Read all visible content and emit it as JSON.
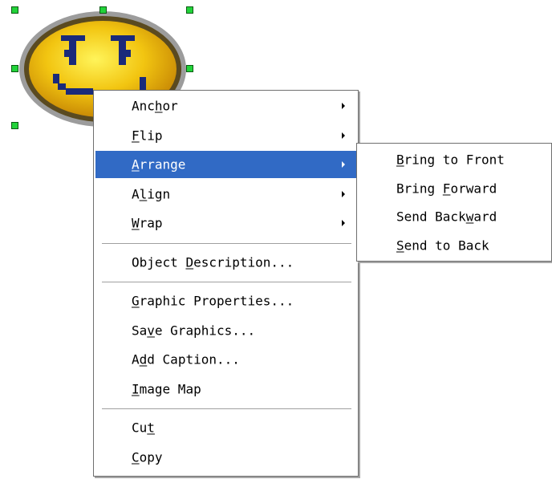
{
  "context_menu": {
    "groups": [
      [
        {
          "pre": "Anc",
          "key": "h",
          "post": "or",
          "submenu": true
        },
        {
          "pre": "",
          "key": "F",
          "post": "lip",
          "submenu": true
        },
        {
          "pre": "",
          "key": "A",
          "post": "rrange",
          "submenu": true,
          "highlighted": true
        },
        {
          "pre": "A",
          "key": "l",
          "post": "ign",
          "submenu": true
        },
        {
          "pre": "",
          "key": "W",
          "post": "rap",
          "submenu": true
        }
      ],
      [
        {
          "pre": "Object ",
          "key": "D",
          "post": "escription...",
          "submenu": false
        }
      ],
      [
        {
          "pre": "",
          "key": "G",
          "post": "raphic Properties...",
          "submenu": false
        },
        {
          "pre": "Sa",
          "key": "v",
          "post": "e Graphics...",
          "submenu": false
        },
        {
          "pre": "A",
          "key": "d",
          "post": "d Caption...",
          "submenu": false
        },
        {
          "pre": "",
          "key": "I",
          "post": "mage Map",
          "submenu": false
        }
      ],
      [
        {
          "pre": "Cu",
          "key": "t",
          "post": "",
          "submenu": false
        },
        {
          "pre": "",
          "key": "C",
          "post": "opy",
          "submenu": false
        }
      ]
    ]
  },
  "arrange_submenu": {
    "items": [
      {
        "pre": "",
        "key": "B",
        "post": "ring to Front"
      },
      {
        "pre": "Bring ",
        "key": "F",
        "post": "orward"
      },
      {
        "pre": "Send Back",
        "key": "w",
        "post": "ard"
      },
      {
        "pre": "",
        "key": "S",
        "post": "end to Back"
      }
    ]
  },
  "colors": {
    "highlight": "#316ac5",
    "selection_handle": "#22d33a",
    "smiley_face": "#f2c511",
    "smiley_features": "#1a2a7a"
  },
  "icons": {
    "graphic": "smiley-face-icon",
    "submenu_arrow": "submenu-arrow-icon"
  }
}
